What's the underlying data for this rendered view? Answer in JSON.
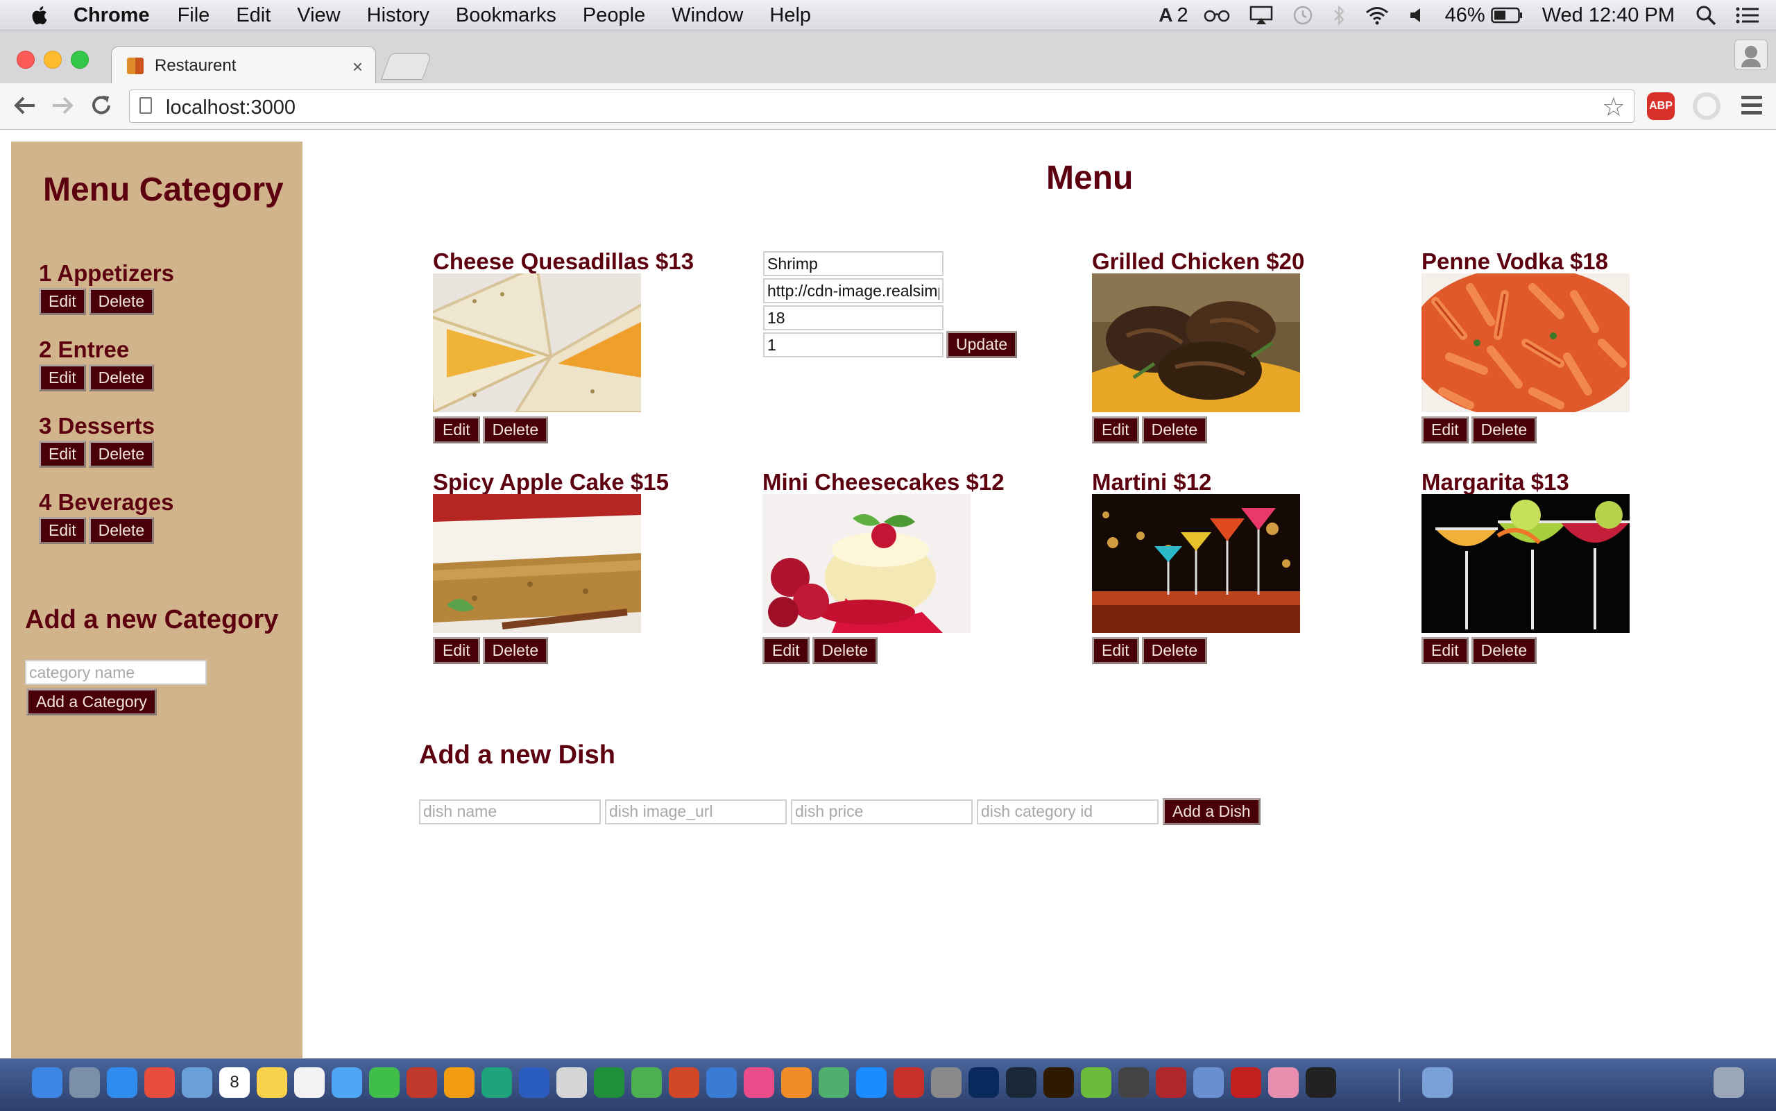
{
  "menubar": {
    "app_name": "Chrome",
    "items": [
      "File",
      "Edit",
      "View",
      "History",
      "Bookmarks",
      "People",
      "Window",
      "Help"
    ],
    "status": {
      "adobe_count": "2",
      "battery": "46%",
      "datetime": "Wed 12:40 PM"
    },
    "icons": [
      "apple-icon",
      "adobe-icon",
      "glasses-icon",
      "airplay-icon",
      "time-machine-icon",
      "bluetooth-icon",
      "wifi-icon",
      "volume-icon",
      "battery-icon",
      "spotlight-icon",
      "notification-center-icon"
    ]
  },
  "browser": {
    "tab_title": "Restaurent",
    "tab_close": "×",
    "url": "localhost:3000",
    "extension_abp": "ABP"
  },
  "sidebar": {
    "title": "Menu Category",
    "categories": [
      {
        "label": "1 Appetizers"
      },
      {
        "label": "2 Entree"
      },
      {
        "label": "3 Desserts"
      },
      {
        "label": "4 Beverages"
      }
    ],
    "edit_label": "Edit",
    "delete_label": "Delete",
    "add_title": "Add a new Category",
    "add_placeholder": "category name",
    "add_button": "Add a Category"
  },
  "menu": {
    "title": "Menu",
    "dishes": [
      {
        "title": "Cheese Quesadillas $13",
        "image": "quesadilla-photo"
      },
      {
        "title": "Grilled Chicken $20",
        "image": "grilled-chicken-photo"
      },
      {
        "title": "Penne Vodka $18",
        "image": "penne-pasta-photo"
      },
      {
        "title": "Spicy Apple Cake $15",
        "image": "apple-cake-photo"
      },
      {
        "title": "Mini Cheesecakes $12",
        "image": "cheesecake-photo"
      },
      {
        "title": "Martini $12",
        "image": "martini-glasses-photo"
      },
      {
        "title": "Margarita $13",
        "image": "margarita-glasses-photo"
      }
    ],
    "edit_form": {
      "name_value": "Shrimp",
      "image_value": "http://cdn-image.realsimple",
      "price_value": "18",
      "category_value": "1",
      "update_button": "Update"
    }
  },
  "add_dish": {
    "title": "Add a new Dish",
    "name_placeholder": "dish name",
    "image_placeholder": "dish image_url",
    "price_placeholder": "dish price",
    "category_placeholder": "dish category id",
    "button": "Add a Dish"
  },
  "dock": {
    "calendar_day": "8",
    "apps": [
      "finder",
      "launchpad",
      "safari",
      "chrome",
      "preview",
      "calendar",
      "notes",
      "reminders",
      "messages",
      "facetime",
      "photo-booth",
      "photos",
      "pycharm",
      "word",
      "textedit",
      "excel",
      "numbers",
      "powerpoint",
      "keynote",
      "itunes",
      "ibooks",
      "atom",
      "app-store",
      "acrobat",
      "system-preferences",
      "photoshop",
      "lightroom",
      "illustrator",
      "utorrent",
      "sublime-text",
      "filezilla",
      "preview-docs",
      "acrobat-reader",
      "photos-flower",
      "terminal",
      "downloads",
      "trash"
    ]
  }
}
